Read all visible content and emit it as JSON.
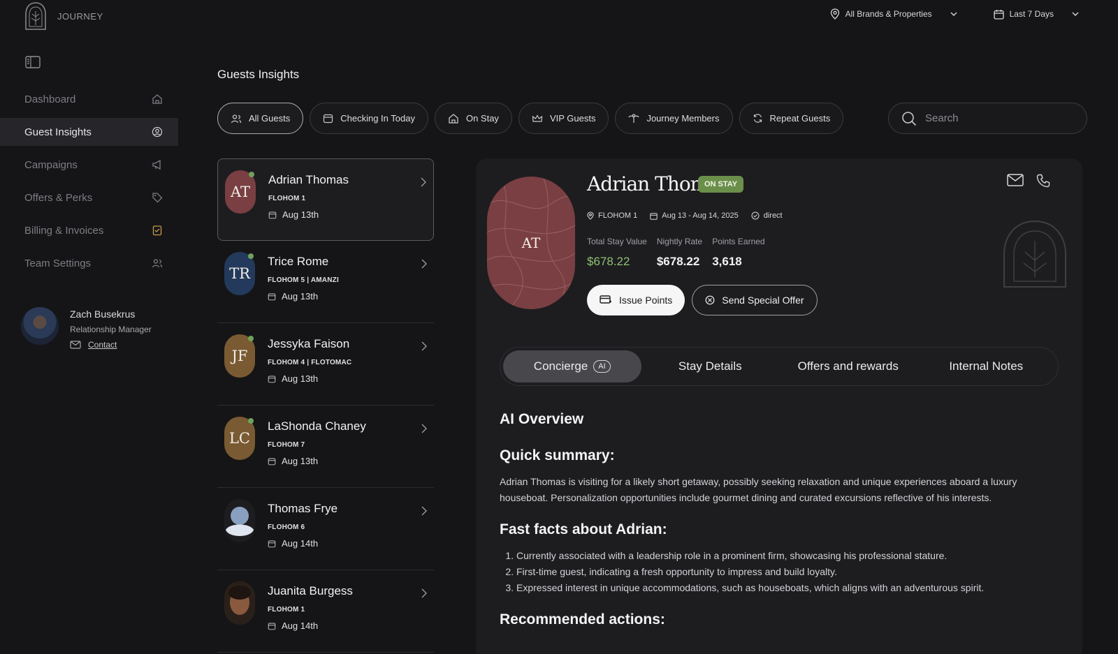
{
  "brand": {
    "name": "JOURNEY"
  },
  "topbar": {
    "property_filter": "All Brands & Properties",
    "date_filter": "Last 7 Days"
  },
  "sidebar": {
    "items": [
      {
        "label": "Dashboard",
        "icon": "home-icon"
      },
      {
        "label": "Guest Insights",
        "icon": "user-circle-icon",
        "active": true
      },
      {
        "label": "Campaigns",
        "icon": "megaphone-icon"
      },
      {
        "label": "Offers & Perks",
        "icon": "tag-icon"
      },
      {
        "label": "Billing & Invoices",
        "icon": "invoice-icon"
      },
      {
        "label": "Team Settings",
        "icon": "team-icon"
      }
    ],
    "profile": {
      "name": "Zach Busekrus",
      "role": "Relationship Manager",
      "contact_label": "Contact"
    }
  },
  "page": {
    "title": "Guests Insights"
  },
  "filters": [
    {
      "label": "All Guests",
      "icon": "users-icon",
      "active": true
    },
    {
      "label": "Checking In Today",
      "icon": "calendar-icon"
    },
    {
      "label": "On Stay",
      "icon": "home-icon"
    },
    {
      "label": "VIP Guests",
      "icon": "crown-icon"
    },
    {
      "label": "Journey Members",
      "icon": "palm-icon"
    },
    {
      "label": "Repeat Guests",
      "icon": "refresh-icon"
    }
  ],
  "search": {
    "placeholder": "Search"
  },
  "guests": [
    {
      "initials": "AT",
      "name": "Adrian Thomas",
      "property": "FLOHOM 1",
      "date": "Aug 13th",
      "color": "#7a3f42",
      "online": true
    },
    {
      "initials": "TR",
      "name": "Trice Rome",
      "property": "FLOHOM 5 | AMANZI",
      "date": "Aug 13th",
      "color": "#233a5c",
      "online": true
    },
    {
      "initials": "JF",
      "name": "Jessyka Faison",
      "property": "FLOHOM 4 | FLOTOMAC",
      "date": "Aug 13th",
      "color": "#7a5a32",
      "online": true
    },
    {
      "initials": "LC",
      "name": "LaShonda Chaney",
      "property": "FLOHOM 7",
      "date": "Aug 13th",
      "color": "#7a5a32",
      "online": true
    },
    {
      "initials": "",
      "name": "Thomas Frye",
      "property": "FLOHOM 6",
      "date": "Aug 14th",
      "color": "#8aa0c0",
      "online": false
    },
    {
      "initials": "",
      "name": "Juanita Burgess",
      "property": "FLOHOM 1",
      "date": "Aug 14th",
      "color": "#6b4a34",
      "online": false
    }
  ],
  "detail": {
    "initials": "AT",
    "name": "Adrian Thomas",
    "status": "ON STAY",
    "property": "FLOHOM 1",
    "dates": "Aug 13 - Aug 14, 2025",
    "channel": "direct",
    "stats": [
      {
        "label": "Total Stay Value",
        "value": "$678.22"
      },
      {
        "label": "Nightly Rate",
        "value": "$678.22"
      },
      {
        "label": "Points Earned",
        "value": "3,618"
      }
    ],
    "issue_points": "Issue Points",
    "send_offer": "Send Special Offer",
    "tabs": [
      {
        "label": "Concierge",
        "pill": "AI",
        "active": true
      },
      {
        "label": "Stay Details"
      },
      {
        "label": "Offers and rewards"
      },
      {
        "label": "Internal Notes"
      }
    ],
    "overview_title": "AI Overview",
    "summary_title": "Quick summary:",
    "summary": "Adrian Thomas is visiting for a likely short getaway, possibly seeking relaxation and unique experiences aboard a luxury houseboat. Personalization opportunities include gourmet dining and curated excursions reflective of his interests.",
    "facts_title": "Fast facts about Adrian:",
    "facts": [
      "Currently associated with a leadership role in a prominent firm, showcasing his professional stature.",
      "First-time guest, indicating a fresh opportunity to impress and build loyalty.",
      "Expressed interest in unique accommodations, such as houseboats, which aligns with an adventurous spirit."
    ],
    "actions_title": "Recommended actions:"
  },
  "colors": {
    "accent_green": "#6b8f4a",
    "bg": "#151517",
    "panel": "#1d1d20"
  }
}
